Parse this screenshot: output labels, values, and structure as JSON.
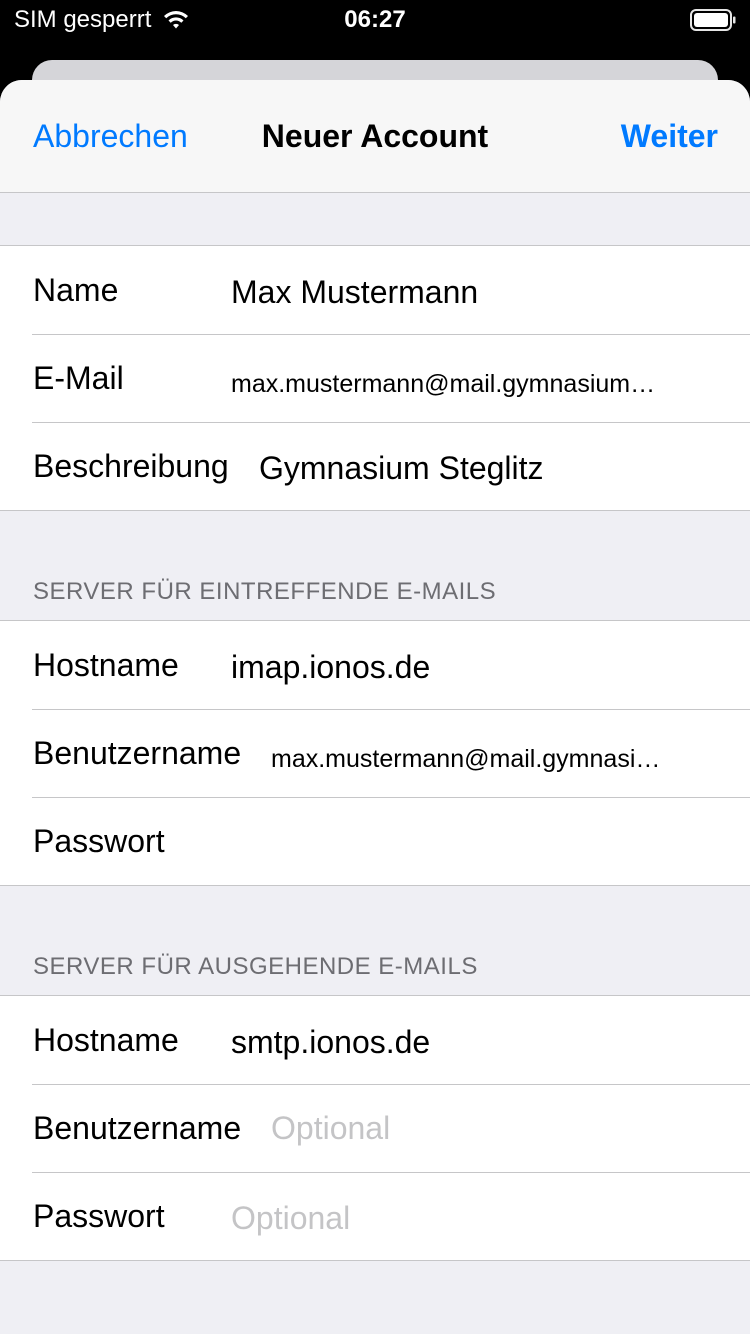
{
  "status_bar": {
    "carrier": "SIM gesperrt",
    "time": "06:27",
    "icons": [
      "wifi-icon",
      "battery-icon"
    ]
  },
  "nav": {
    "cancel": "Abbrechen",
    "title": "Neuer Account",
    "next": "Weiter"
  },
  "account": {
    "name_label": "Name",
    "name_value": "Max Mustermann",
    "email_label": "E-Mail",
    "email_value": "max.mustermann@mail.gymnasium…",
    "description_label": "Beschreibung",
    "description_value": "Gymnasium Steglitz"
  },
  "incoming": {
    "header": "SERVER FÜR EINTREFFENDE E-MAILS",
    "host_label": "Hostname",
    "host_value": "imap.ionos.de",
    "user_label": "Benutzername",
    "user_value": "max.mustermann@mail.gymnasi…",
    "password_label": "Passwort",
    "password_value": ""
  },
  "outgoing": {
    "header": "SERVER FÜR AUSGEHENDE E-MAILS",
    "host_label": "Hostname",
    "host_value": "smtp.ionos.de",
    "user_label": "Benutzername",
    "user_placeholder": "Optional",
    "password_label": "Passwort",
    "password_placeholder": "Optional"
  },
  "colors": {
    "accent": "#007aff",
    "grouped_background": "#efeff4",
    "separator": "#c6c6c8",
    "secondary_label": "#6d6d72",
    "placeholder": "#c4c4c6"
  }
}
